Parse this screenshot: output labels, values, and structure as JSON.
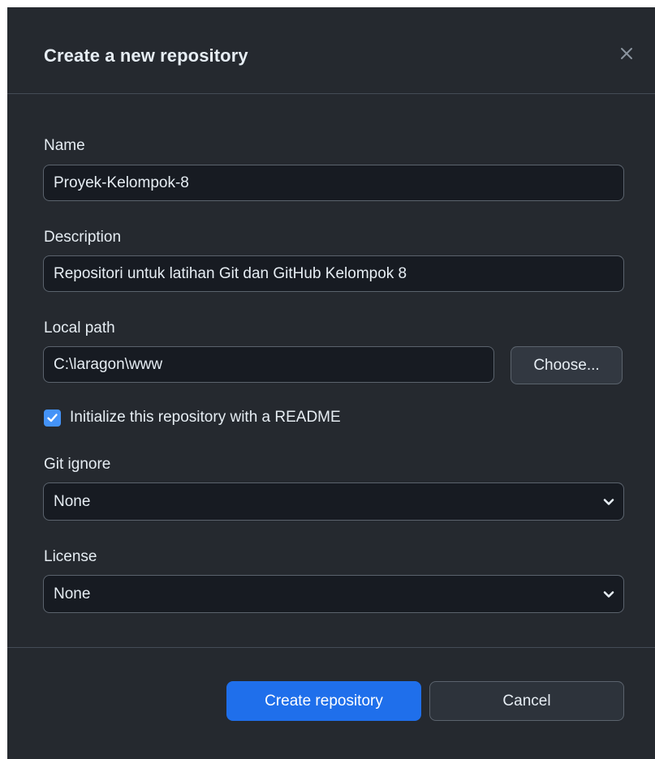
{
  "dialog": {
    "title": "Create a new repository",
    "close_icon": "close-icon"
  },
  "form": {
    "name": {
      "label": "Name",
      "value": "Proyek-Kelompok-8"
    },
    "description": {
      "label": "Description",
      "value": "Repositori untuk latihan Git dan GitHub Kelompok 8"
    },
    "local_path": {
      "label": "Local path",
      "value": "C:\\laragon\\www",
      "choose_label": "Choose..."
    },
    "readme": {
      "label": "Initialize this repository with a README",
      "checked": true
    },
    "git_ignore": {
      "label": "Git ignore",
      "selected": "None"
    },
    "license": {
      "label": "License",
      "selected": "None"
    }
  },
  "footer": {
    "create_label": "Create repository",
    "cancel_label": "Cancel"
  },
  "colors": {
    "background": "#25292f",
    "input_bg": "#171b22",
    "border": "#5b636d",
    "accent": "#1f6feb",
    "checkbox": "#4493f8",
    "text": "#e6edf3"
  }
}
